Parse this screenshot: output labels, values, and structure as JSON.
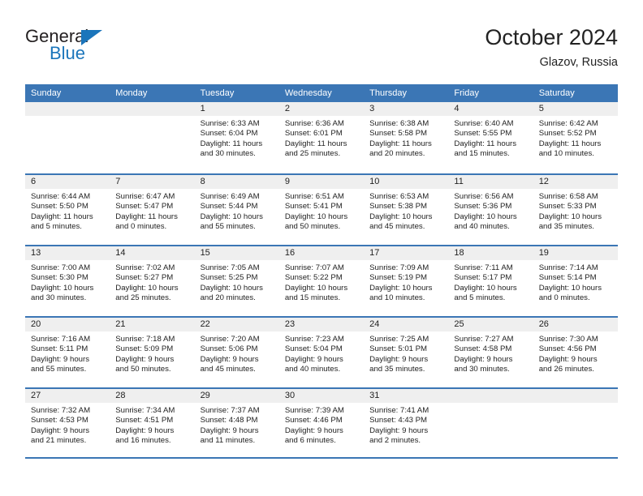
{
  "brand": {
    "name_top": "General",
    "name_bottom": "Blue",
    "accent_color": "#1b75bb"
  },
  "header": {
    "title": "October 2024",
    "subtitle": "Glazov, Russia"
  },
  "theme": {
    "header_blue": "#3b76b5",
    "daynum_band": "#efefef",
    "text": "#222222"
  },
  "weekdays": [
    "Sunday",
    "Monday",
    "Tuesday",
    "Wednesday",
    "Thursday",
    "Friday",
    "Saturday"
  ],
  "weeks": [
    [
      {
        "day": ""
      },
      {
        "day": ""
      },
      {
        "day": "1",
        "sunrise": "Sunrise: 6:33 AM",
        "sunset": "Sunset: 6:04 PM",
        "daylight_line1": "Daylight: 11 hours",
        "daylight_line2": "and 30 minutes."
      },
      {
        "day": "2",
        "sunrise": "Sunrise: 6:36 AM",
        "sunset": "Sunset: 6:01 PM",
        "daylight_line1": "Daylight: 11 hours",
        "daylight_line2": "and 25 minutes."
      },
      {
        "day": "3",
        "sunrise": "Sunrise: 6:38 AM",
        "sunset": "Sunset: 5:58 PM",
        "daylight_line1": "Daylight: 11 hours",
        "daylight_line2": "and 20 minutes."
      },
      {
        "day": "4",
        "sunrise": "Sunrise: 6:40 AM",
        "sunset": "Sunset: 5:55 PM",
        "daylight_line1": "Daylight: 11 hours",
        "daylight_line2": "and 15 minutes."
      },
      {
        "day": "5",
        "sunrise": "Sunrise: 6:42 AM",
        "sunset": "Sunset: 5:52 PM",
        "daylight_line1": "Daylight: 11 hours",
        "daylight_line2": "and 10 minutes."
      }
    ],
    [
      {
        "day": "6",
        "sunrise": "Sunrise: 6:44 AM",
        "sunset": "Sunset: 5:50 PM",
        "daylight_line1": "Daylight: 11 hours",
        "daylight_line2": "and 5 minutes."
      },
      {
        "day": "7",
        "sunrise": "Sunrise: 6:47 AM",
        "sunset": "Sunset: 5:47 PM",
        "daylight_line1": "Daylight: 11 hours",
        "daylight_line2": "and 0 minutes."
      },
      {
        "day": "8",
        "sunrise": "Sunrise: 6:49 AM",
        "sunset": "Sunset: 5:44 PM",
        "daylight_line1": "Daylight: 10 hours",
        "daylight_line2": "and 55 minutes."
      },
      {
        "day": "9",
        "sunrise": "Sunrise: 6:51 AM",
        "sunset": "Sunset: 5:41 PM",
        "daylight_line1": "Daylight: 10 hours",
        "daylight_line2": "and 50 minutes."
      },
      {
        "day": "10",
        "sunrise": "Sunrise: 6:53 AM",
        "sunset": "Sunset: 5:38 PM",
        "daylight_line1": "Daylight: 10 hours",
        "daylight_line2": "and 45 minutes."
      },
      {
        "day": "11",
        "sunrise": "Sunrise: 6:56 AM",
        "sunset": "Sunset: 5:36 PM",
        "daylight_line1": "Daylight: 10 hours",
        "daylight_line2": "and 40 minutes."
      },
      {
        "day": "12",
        "sunrise": "Sunrise: 6:58 AM",
        "sunset": "Sunset: 5:33 PM",
        "daylight_line1": "Daylight: 10 hours",
        "daylight_line2": "and 35 minutes."
      }
    ],
    [
      {
        "day": "13",
        "sunrise": "Sunrise: 7:00 AM",
        "sunset": "Sunset: 5:30 PM",
        "daylight_line1": "Daylight: 10 hours",
        "daylight_line2": "and 30 minutes."
      },
      {
        "day": "14",
        "sunrise": "Sunrise: 7:02 AM",
        "sunset": "Sunset: 5:27 PM",
        "daylight_line1": "Daylight: 10 hours",
        "daylight_line2": "and 25 minutes."
      },
      {
        "day": "15",
        "sunrise": "Sunrise: 7:05 AM",
        "sunset": "Sunset: 5:25 PM",
        "daylight_line1": "Daylight: 10 hours",
        "daylight_line2": "and 20 minutes."
      },
      {
        "day": "16",
        "sunrise": "Sunrise: 7:07 AM",
        "sunset": "Sunset: 5:22 PM",
        "daylight_line1": "Daylight: 10 hours",
        "daylight_line2": "and 15 minutes."
      },
      {
        "day": "17",
        "sunrise": "Sunrise: 7:09 AM",
        "sunset": "Sunset: 5:19 PM",
        "daylight_line1": "Daylight: 10 hours",
        "daylight_line2": "and 10 minutes."
      },
      {
        "day": "18",
        "sunrise": "Sunrise: 7:11 AM",
        "sunset": "Sunset: 5:17 PM",
        "daylight_line1": "Daylight: 10 hours",
        "daylight_line2": "and 5 minutes."
      },
      {
        "day": "19",
        "sunrise": "Sunrise: 7:14 AM",
        "sunset": "Sunset: 5:14 PM",
        "daylight_line1": "Daylight: 10 hours",
        "daylight_line2": "and 0 minutes."
      }
    ],
    [
      {
        "day": "20",
        "sunrise": "Sunrise: 7:16 AM",
        "sunset": "Sunset: 5:11 PM",
        "daylight_line1": "Daylight: 9 hours",
        "daylight_line2": "and 55 minutes."
      },
      {
        "day": "21",
        "sunrise": "Sunrise: 7:18 AM",
        "sunset": "Sunset: 5:09 PM",
        "daylight_line1": "Daylight: 9 hours",
        "daylight_line2": "and 50 minutes."
      },
      {
        "day": "22",
        "sunrise": "Sunrise: 7:20 AM",
        "sunset": "Sunset: 5:06 PM",
        "daylight_line1": "Daylight: 9 hours",
        "daylight_line2": "and 45 minutes."
      },
      {
        "day": "23",
        "sunrise": "Sunrise: 7:23 AM",
        "sunset": "Sunset: 5:04 PM",
        "daylight_line1": "Daylight: 9 hours",
        "daylight_line2": "and 40 minutes."
      },
      {
        "day": "24",
        "sunrise": "Sunrise: 7:25 AM",
        "sunset": "Sunset: 5:01 PM",
        "daylight_line1": "Daylight: 9 hours",
        "daylight_line2": "and 35 minutes."
      },
      {
        "day": "25",
        "sunrise": "Sunrise: 7:27 AM",
        "sunset": "Sunset: 4:58 PM",
        "daylight_line1": "Daylight: 9 hours",
        "daylight_line2": "and 30 minutes."
      },
      {
        "day": "26",
        "sunrise": "Sunrise: 7:30 AM",
        "sunset": "Sunset: 4:56 PM",
        "daylight_line1": "Daylight: 9 hours",
        "daylight_line2": "and 26 minutes."
      }
    ],
    [
      {
        "day": "27",
        "sunrise": "Sunrise: 7:32 AM",
        "sunset": "Sunset: 4:53 PM",
        "daylight_line1": "Daylight: 9 hours",
        "daylight_line2": "and 21 minutes."
      },
      {
        "day": "28",
        "sunrise": "Sunrise: 7:34 AM",
        "sunset": "Sunset: 4:51 PM",
        "daylight_line1": "Daylight: 9 hours",
        "daylight_line2": "and 16 minutes."
      },
      {
        "day": "29",
        "sunrise": "Sunrise: 7:37 AM",
        "sunset": "Sunset: 4:48 PM",
        "daylight_line1": "Daylight: 9 hours",
        "daylight_line2": "and 11 minutes."
      },
      {
        "day": "30",
        "sunrise": "Sunrise: 7:39 AM",
        "sunset": "Sunset: 4:46 PM",
        "daylight_line1": "Daylight: 9 hours",
        "daylight_line2": "and 6 minutes."
      },
      {
        "day": "31",
        "sunrise": "Sunrise: 7:41 AM",
        "sunset": "Sunset: 4:43 PM",
        "daylight_line1": "Daylight: 9 hours",
        "daylight_line2": "and 2 minutes."
      },
      {
        "day": ""
      },
      {
        "day": ""
      }
    ]
  ]
}
